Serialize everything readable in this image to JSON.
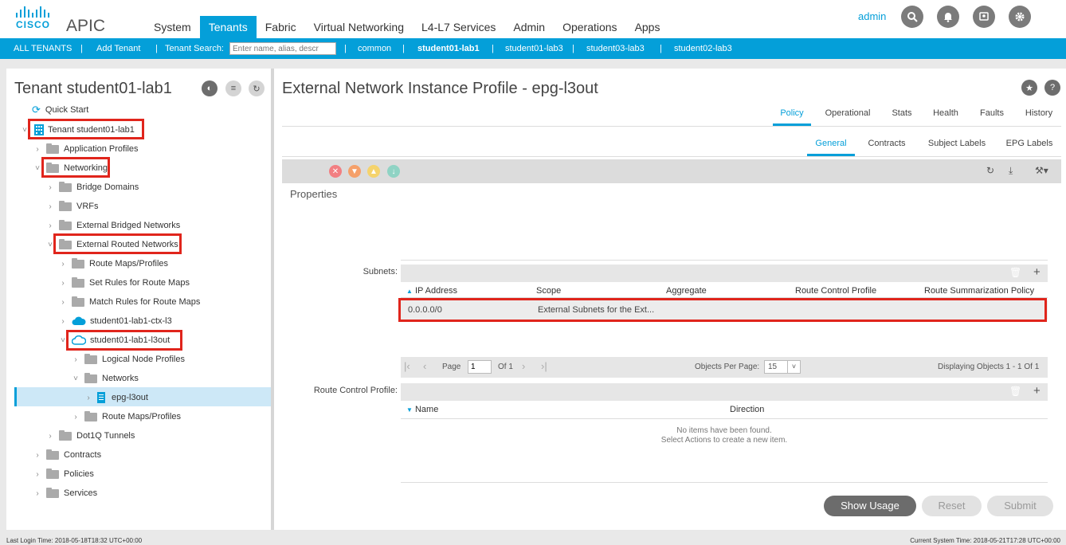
{
  "header": {
    "brand": "CISCO",
    "app_name": "APIC",
    "nav": [
      "System",
      "Tenants",
      "Fabric",
      "Virtual Networking",
      "L4-L7 Services",
      "Admin",
      "Operations",
      "Apps"
    ],
    "active_nav": "Tenants",
    "user": "admin",
    "accent_color": "#049fd9"
  },
  "subnav": {
    "all_tenants": "ALL TENANTS",
    "add_tenant": "Add Tenant",
    "search_label": "Tenant Search:",
    "search_placeholder": "Enter name, alias, descr",
    "tenants": [
      "common",
      "student01-lab1",
      "student01-lab3",
      "student03-lab3",
      "student02-lab3"
    ],
    "sep": "|"
  },
  "left": {
    "title": "Tenant student01-lab1",
    "quick_start": "Quick Start",
    "tree": {
      "tenant": "Tenant student01-lab1",
      "app_profiles": "Application Profiles",
      "networking": "Networking",
      "bridge_domains": "Bridge Domains",
      "vrfs": "VRFs",
      "ext_bridged": "External Bridged Networks",
      "ext_routed": "External Routed Networks",
      "route_maps": "Route Maps/Profiles",
      "set_rules": "Set Rules for Route Maps",
      "match_rules": "Match Rules for Route Maps",
      "ctx_l3": "student01-lab1-ctx-l3",
      "l3out": "student01-lab1-l3out",
      "logical_node": "Logical Node Profiles",
      "networks": "Networks",
      "epg": "epg-l3out",
      "route_maps2": "Route Maps/Profiles",
      "dot1q": "Dot1Q Tunnels",
      "contracts": "Contracts",
      "policies": "Policies",
      "services": "Services"
    }
  },
  "right": {
    "title": "External Network Instance Profile - epg-l3out",
    "tabs": [
      "Policy",
      "Operational",
      "Stats",
      "Health",
      "Faults",
      "History"
    ],
    "subtabs": [
      "General",
      "Contracts",
      "Subject Labels",
      "EPG Labels"
    ],
    "properties": "Properties",
    "subnets": {
      "label": "Subnets:",
      "columns": [
        "IP Address",
        "Scope",
        "Aggregate",
        "Route Control Profile",
        "Route Summarization Policy"
      ],
      "rows": [
        {
          "ip": "0.0.0.0/0",
          "scope": "External Subnets for the Ext..."
        }
      ]
    },
    "paging": {
      "page_label": "Page",
      "page": "1",
      "of": "Of 1",
      "per_page_label": "Objects Per Page:",
      "per_page": "15",
      "displaying": "Displaying Objects 1 - 1 Of 1"
    },
    "rcp": {
      "label": "Route Control Profile:",
      "columns": [
        "Name",
        "Direction"
      ],
      "empty1": "No items have been found.",
      "empty2": "Select Actions to create a new item."
    },
    "buttons": {
      "show_usage": "Show Usage",
      "reset": "Reset",
      "submit": "Submit"
    }
  },
  "footer": {
    "last_login": "Last Login Time: 2018-05-18T18:32 UTC+00:00",
    "current_time": "Current System Time: 2018-05-21T17:28 UTC+00:00"
  }
}
